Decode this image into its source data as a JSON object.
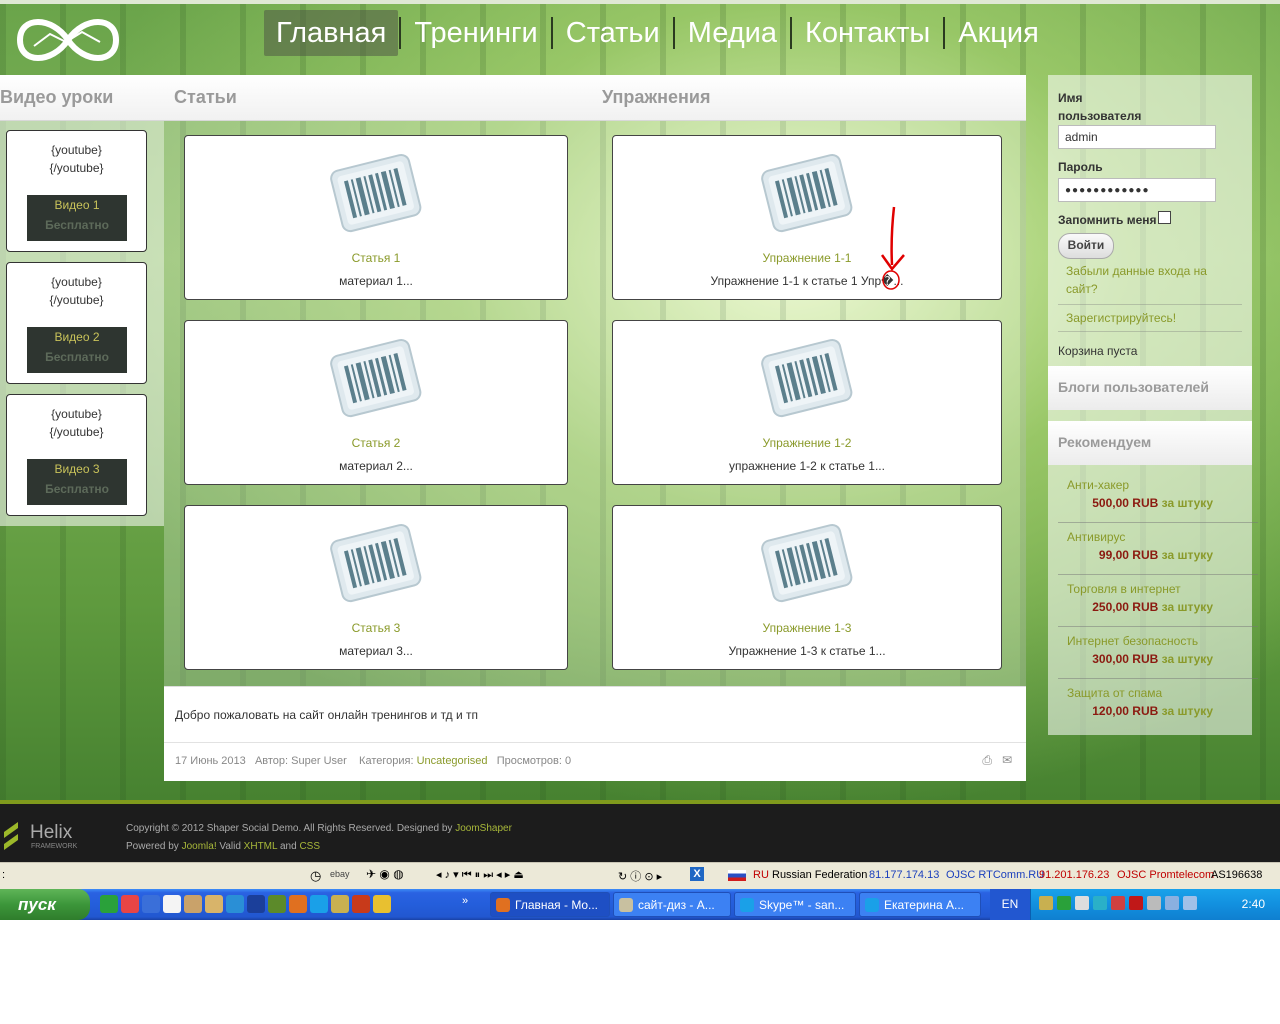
{
  "nav": {
    "items": [
      "Главная",
      "Тренинги",
      "Статьи",
      "Медиа",
      "Контакты",
      "Акция"
    ],
    "active": "Главная"
  },
  "headers": {
    "videos": "Видео уроки",
    "articles": "Статьи",
    "exercises": "Упражнения"
  },
  "videos": [
    {
      "open": "{youtube}",
      "close": "{/youtube}",
      "title": "Видео 1",
      "price": "Бесплатно"
    },
    {
      "open": "{youtube}",
      "close": "{/youtube}",
      "title": "Видео 2",
      "price": "Бесплатно"
    },
    {
      "open": "{youtube}",
      "close": "{/youtube}",
      "title": "Видео 3",
      "price": "Бесплатно"
    }
  ],
  "articles": [
    {
      "title": "Статья 1",
      "desc": "материал 1..."
    },
    {
      "title": "Статья 2",
      "desc": "материал 2..."
    },
    {
      "title": "Статья 3",
      "desc": "материал 3..."
    }
  ],
  "exercises": [
    {
      "title": "Упражнение 1-1",
      "desc": "Упражнение 1-1 к статье 1 Упр�..."
    },
    {
      "title": "Упражнение 1-2",
      "desc": "упражнение 1-2 к статье 1..."
    },
    {
      "title": "Упражнение 1-3",
      "desc": "Упражнение 1-3 к статье 1..."
    }
  ],
  "article": {
    "welcome": "Добро пожаловать на сайт онлайн тренингов и тд и тп",
    "date": "17 Июнь 2013",
    "author": "Автор: Super User",
    "category_label": "Категория:",
    "category": "Uncategorised",
    "views": "Просмотров: 0"
  },
  "login": {
    "username_label": "Имя пользователя",
    "username_value": "admin",
    "password_label": "Пароль",
    "password_value": "●●●●●●●●●●●●",
    "remember_label": "Запомнить меня",
    "submit": "Войти",
    "forgot": "Забыли данные входа на сайт?",
    "register": "Зарегистрируйтесь!"
  },
  "cart": {
    "empty": "Корзина пуста"
  },
  "modules": {
    "blogs": "Блоги пользователей",
    "recommend": "Рекомендуем"
  },
  "products": [
    {
      "name": "Анти-хакер",
      "price": "500,00 RUB",
      "per": "за штуку"
    },
    {
      "name": "Антивирус",
      "price": "99,00 RUB",
      "per": "за штуку"
    },
    {
      "name": "Торговля в интернет",
      "price": "250,00 RUB",
      "per": "за штуку"
    },
    {
      "name": "Интернет безопасность",
      "price": "300,00 RUB",
      "per": "за штуку"
    },
    {
      "name": "Защита от спама",
      "price": "120,00 RUB",
      "per": "за штуку"
    }
  ],
  "footer": {
    "brand": "Helix",
    "brand_sub": "FRAMEWORK",
    "copyright": "Copyright © 2012 Shaper Social Demo. All Rights Reserved. Designed by",
    "designer": "JoomShaper",
    "powered": "Powered by",
    "joomla": "Joomla!",
    "valid": "Valid",
    "xhtml": "XHTML",
    "and": "and",
    "css": "CSS"
  },
  "statusbar": {
    "ebay": "ebay",
    "country_code": "RU",
    "country": "Russian Federation",
    "ip1": "81.177.174.13",
    "isp1": "OJSC RTComm.RU",
    "ip2": "91.201.176.23",
    "isp2": "OJSC Promtelecom",
    "as": "AS196638"
  },
  "taskbar": {
    "start": "пуск",
    "tasks": [
      "Главная - Mo...",
      "сайт-диз - A...",
      "Skype™ - san...",
      "Екатерина A..."
    ],
    "lang": "EN",
    "clock": "2:40"
  },
  "colors": {
    "accent": "#8a9a2a",
    "price": "#8b1a10",
    "annotation": "#e00000"
  }
}
